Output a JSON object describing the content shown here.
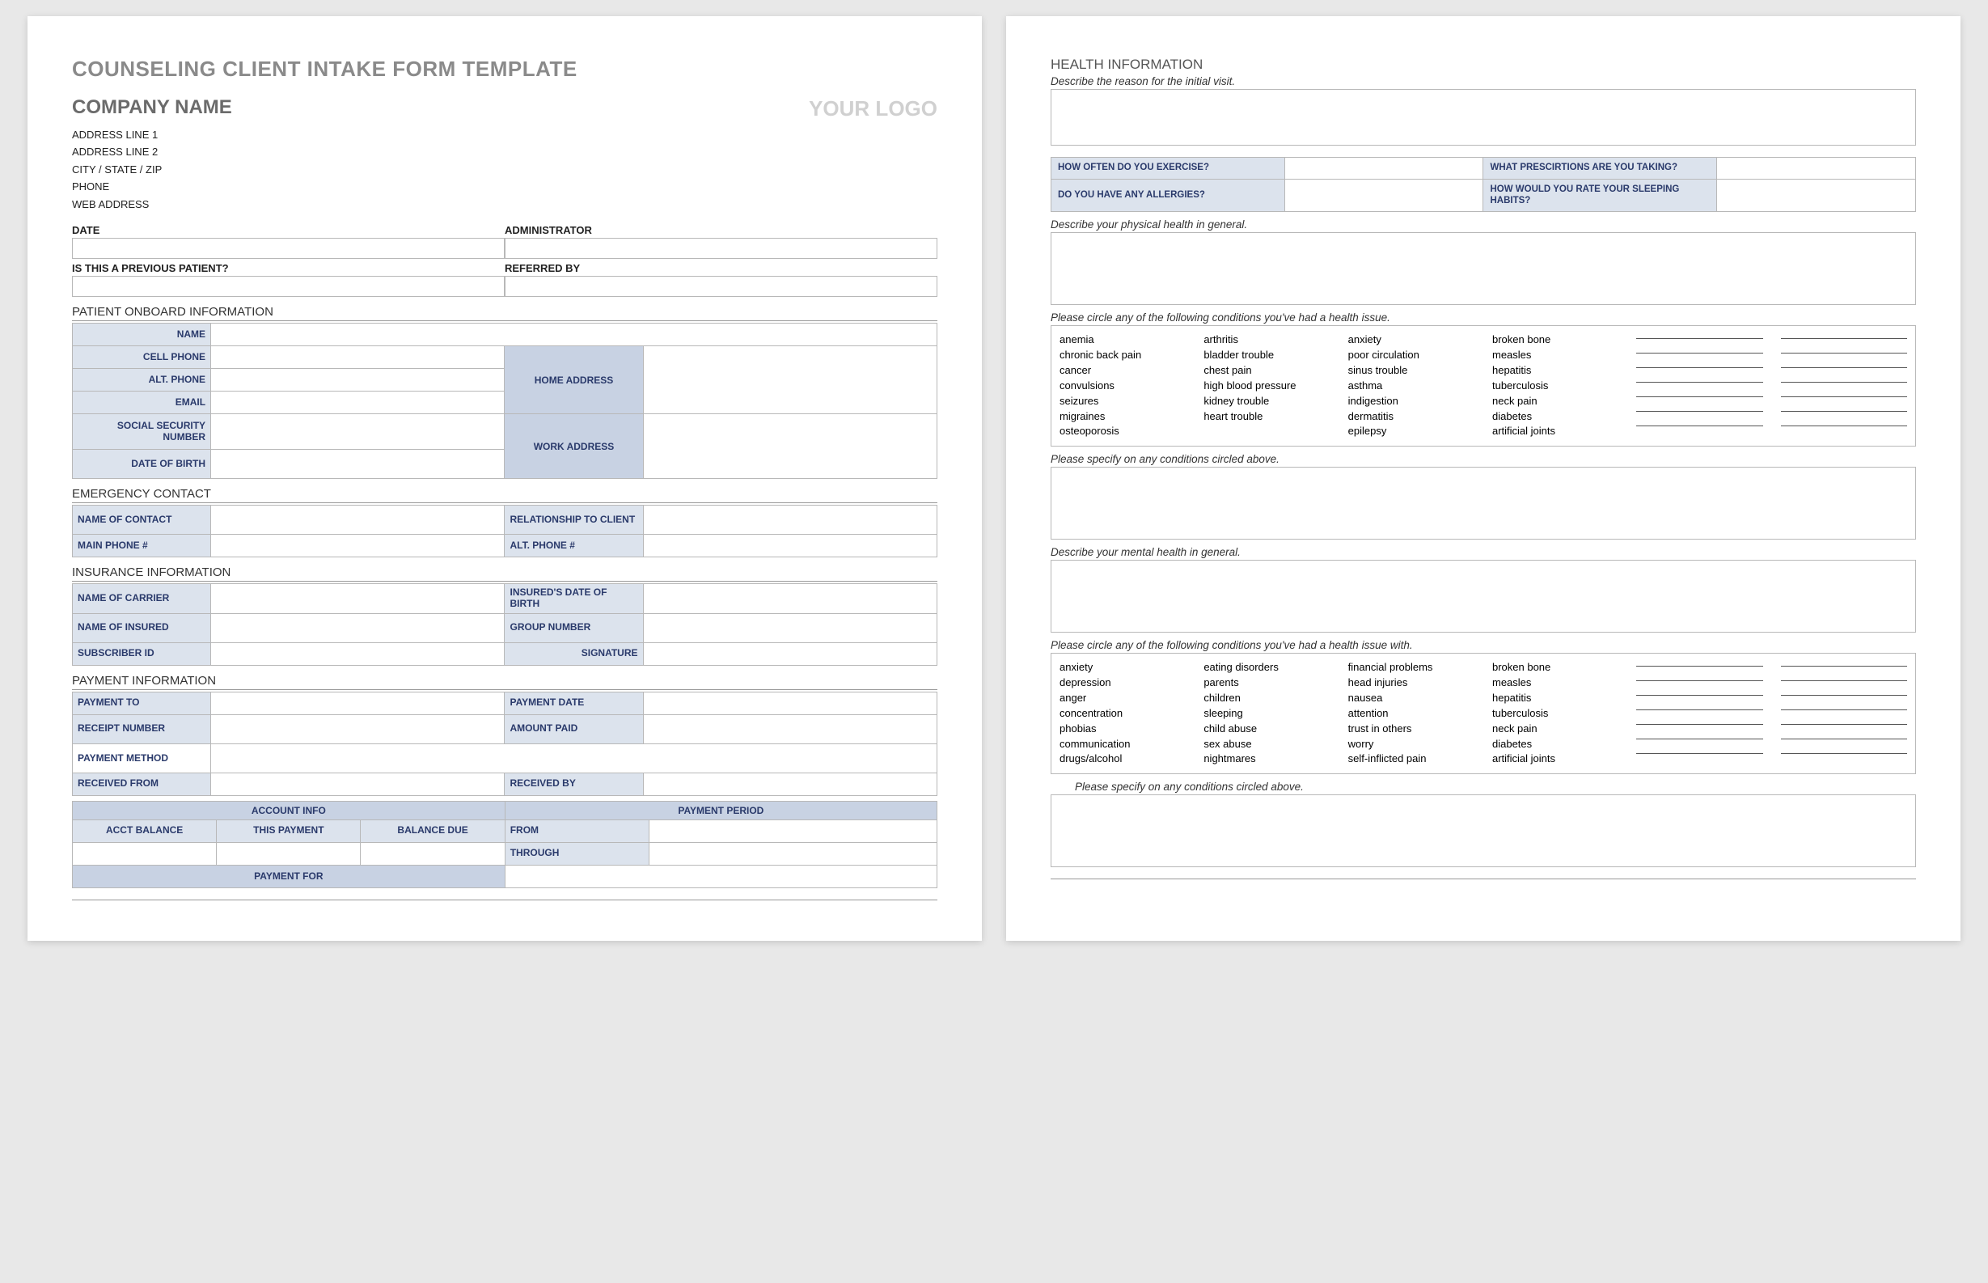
{
  "page1": {
    "formTitle": "COUNSELING CLIENT INTAKE FORM TEMPLATE",
    "companyName": "COMPANY NAME",
    "logoText": "YOUR LOGO",
    "companyInfo": {
      "addr1": "ADDRESS LINE 1",
      "addr2": "ADDRESS LINE 2",
      "csz": "CITY / STATE / ZIP",
      "phone": "PHONE",
      "web": "WEB ADDRESS"
    },
    "labels": {
      "date": "DATE",
      "administrator": "ADMINISTRATOR",
      "prevPatient": "IS THIS A PREVIOUS PATIENT?",
      "referredBy": "REFERRED BY"
    },
    "patient": {
      "sectionTitle": "PATIENT ONBOARD INFORMATION",
      "name": "NAME",
      "cellPhone": "CELL PHONE",
      "altPhone": "ALT. PHONE",
      "email": "EMAIL",
      "ssn": "SOCIAL SECURITY NUMBER",
      "dob": "DATE OF BIRTH",
      "homeAddress": "HOME ADDRESS",
      "workAddress": "WORK ADDRESS"
    },
    "emergency": {
      "sectionTitle": "EMERGENCY CONTACT",
      "nameOfContact": "NAME OF CONTACT",
      "relationship": "RELATIONSHIP TO CLIENT",
      "mainPhone": "MAIN PHONE #",
      "altPhone": "ALT. PHONE #"
    },
    "insurance": {
      "sectionTitle": "INSURANCE INFORMATION",
      "carrier": "NAME OF CARRIER",
      "insuredDob": "INSURED'S DATE OF BIRTH",
      "insured": "NAME OF INSURED",
      "groupNum": "GROUP NUMBER",
      "subscriberId": "SUBSCRIBER ID",
      "signature": "SIGNATURE"
    },
    "payment": {
      "sectionTitle": "PAYMENT INFORMATION",
      "paymentTo": "PAYMENT TO",
      "paymentDate": "PAYMENT DATE",
      "receiptNumber": "RECEIPT NUMBER",
      "amountPaid": "AMOUNT PAID",
      "paymentMethod": "PAYMENT METHOD",
      "receivedFrom": "RECEIVED FROM",
      "receivedBy": "RECEIVED BY",
      "accountInfo": "ACCOUNT INFO",
      "paymentPeriod": "PAYMENT PERIOD",
      "acctBalance": "ACCT BALANCE",
      "thisPayment": "THIS PAYMENT",
      "balanceDue": "BALANCE DUE",
      "from": "FROM",
      "through": "THROUGH",
      "paymentFor": "PAYMENT FOR"
    }
  },
  "page2": {
    "title": "HEALTH INFORMATION",
    "instr": {
      "reason": "Describe the reason for the initial visit.",
      "physical": "Describe your physical health in general.",
      "circlePhys": "Please circle any of the following conditions you've had a health issue.",
      "specifyPhys": "Please specify on any conditions circled above.",
      "mental": "Describe your mental health in general.",
      "circleMental": "Please circle any of the following conditions you've had a health issue with.",
      "specifyMental": "Please specify on any conditions circled above."
    },
    "questions": {
      "exercise": "HOW OFTEN DO YOU EXERCISE?",
      "prescriptions": "WHAT PRESCIRTIONS ARE YOU TAKING?",
      "allergies": "DO YOU HAVE ANY ALLERGIES?",
      "sleeping": "HOW WOULD YOU RATE YOUR SLEEPING HABITS?"
    },
    "physConditions": {
      "c1": [
        "anemia",
        "chronic back pain",
        "cancer",
        "convulsions",
        "seizures",
        "migraines",
        "osteoporosis"
      ],
      "c2": [
        "arthritis",
        "bladder trouble",
        "chest pain",
        "high blood pressure",
        "kidney trouble",
        "heart trouble"
      ],
      "c3": [
        "anxiety",
        "poor circulation",
        "sinus trouble",
        "asthma",
        "indigestion",
        "dermatitis",
        "epilepsy"
      ],
      "c4": [
        "broken bone",
        "measles",
        "hepatitis",
        "tuberculosis",
        "neck pain",
        "diabetes",
        "artificial joints"
      ]
    },
    "mentalConditions": {
      "c1": [
        "anxiety",
        "depression",
        "anger",
        "concentration",
        "phobias",
        "communication",
        "drugs/alcohol"
      ],
      "c2": [
        "eating disorders",
        "parents",
        "children",
        "sleeping",
        "child abuse",
        "sex abuse",
        "nightmares"
      ],
      "c3": [
        "financial problems",
        "head injuries",
        "nausea",
        "attention",
        "trust in others",
        "worry",
        "self-inflicted pain"
      ],
      "c4": [
        "broken bone",
        "measles",
        "hepatitis",
        "tuberculosis",
        "neck pain",
        "diabetes",
        "artificial joints"
      ]
    }
  }
}
